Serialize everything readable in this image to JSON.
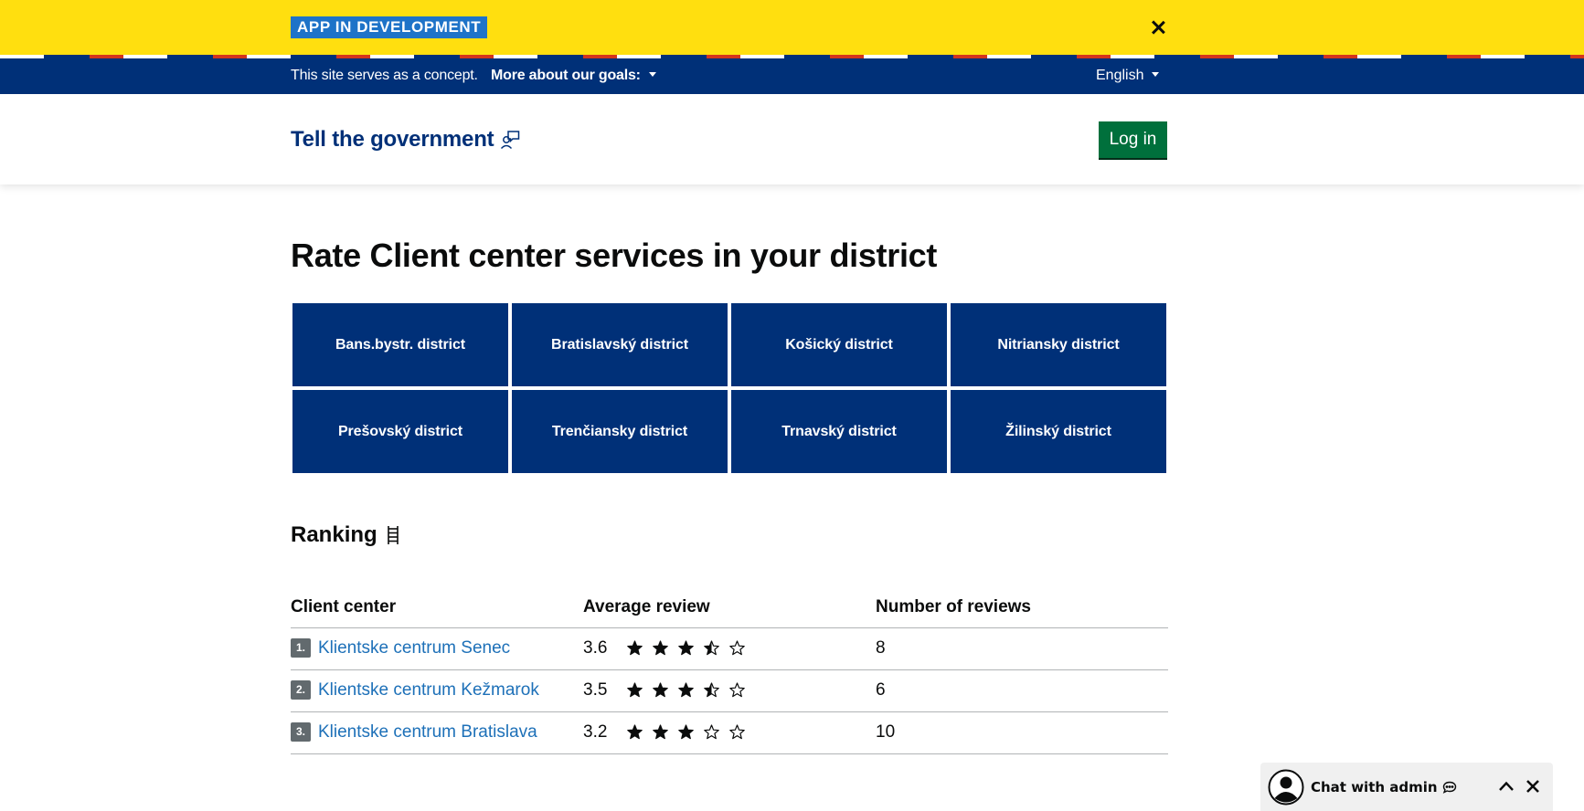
{
  "dev_banner": {
    "badge": "APP IN DEVELOPMENT",
    "close_icon": "close-icon"
  },
  "concept_bar": {
    "text": "This site serves as a concept.",
    "goals_label": "More about our goals:",
    "language": "English"
  },
  "header": {
    "brand": "Tell the government",
    "brand_icon": "feedback-person-icon",
    "login_label": "Log in"
  },
  "main": {
    "title": "Rate Client center services in your district",
    "districts": [
      "Bans.bystr. district",
      "Bratislavský district",
      "Košický district",
      "Nitriansky district",
      "Prešovský district",
      "Trenčiansky district",
      "Trnavský district",
      "Žilinský district"
    ]
  },
  "ranking": {
    "title": "Ranking",
    "title_icon": "ladder-icon",
    "columns": [
      "Client center",
      "Average review",
      "Number of reviews"
    ],
    "rows": [
      {
        "rank": "1.",
        "name": "Klientske centrum Senec",
        "avg": "3.6",
        "rating": 3.5,
        "count": "8"
      },
      {
        "rank": "2.",
        "name": "Klientske centrum Kežmarok",
        "avg": "3.5",
        "rating": 3.5,
        "count": "6"
      },
      {
        "rank": "3.",
        "name": "Klientske centrum Bratislava",
        "avg": "3.2",
        "rating": 3.0,
        "count": "10"
      }
    ]
  },
  "chat": {
    "label": "Chat with admin",
    "avatar_icon": "user-avatar-icon",
    "bubble_icon": "chat-bubble-icon",
    "collapse_icon": "chevron-up-icon",
    "close_icon": "close-icon"
  },
  "colors": {
    "banner_yellow": "#ffdf0f",
    "navy": "#003078",
    "green": "#00703c",
    "link": "#1d70b8",
    "badge_blue": "#1e73c8"
  }
}
